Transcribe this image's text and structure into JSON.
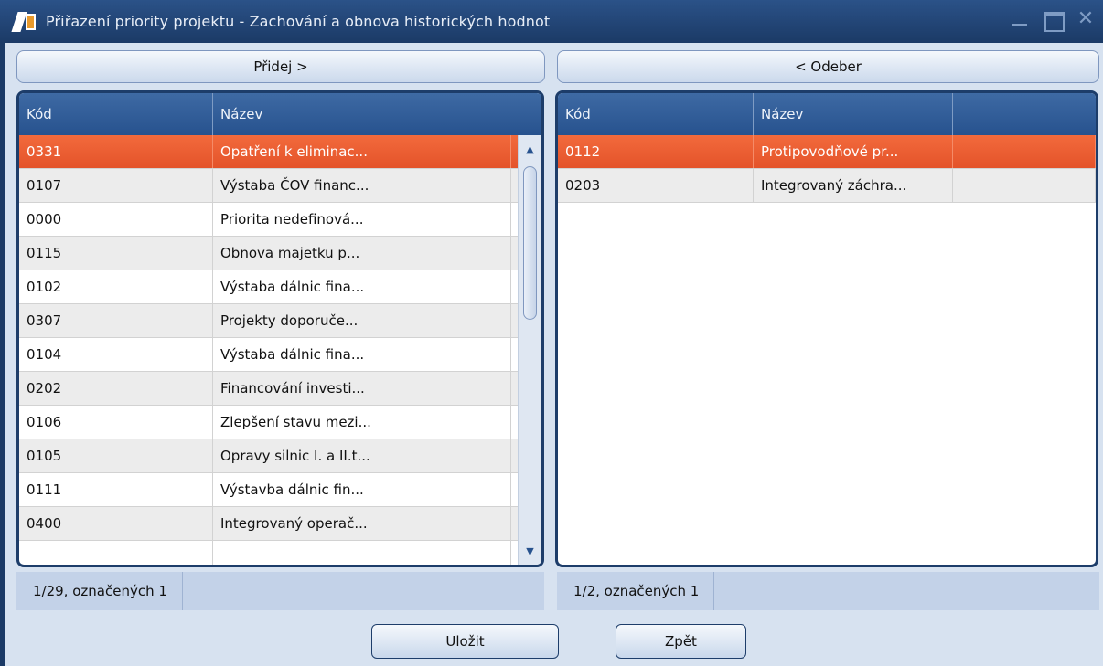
{
  "window": {
    "title": "Přiřazení priority projektu - Zachování a obnova historických hodnot",
    "icon": "app-logo-icon"
  },
  "actions": {
    "add_label": "Přidej  >",
    "remove_label": "<  Odeber",
    "save_label": "Uložit",
    "back_label": "Zpět"
  },
  "left_grid": {
    "columns": [
      "Kód",
      "Název",
      ""
    ],
    "rows": [
      {
        "code": "0331",
        "name": "Opatření k eliminac...",
        "selected": true
      },
      {
        "code": "0107",
        "name": "Výstaba ČOV financ..."
      },
      {
        "code": "0000",
        "name": "Priorita nedefinová..."
      },
      {
        "code": "0115",
        "name": "Obnova majetku p..."
      },
      {
        "code": "0102",
        "name": "Výstaba dálnic fina..."
      },
      {
        "code": "0307",
        "name": "Projekty doporuče..."
      },
      {
        "code": "0104",
        "name": "Výstaba dálnic fina..."
      },
      {
        "code": "0202",
        "name": "Financování investi..."
      },
      {
        "code": "0106",
        "name": "Zlepšení stavu mezi..."
      },
      {
        "code": "0105",
        "name": "Opravy silnic I. a II.t..."
      },
      {
        "code": "0111",
        "name": "Výstavba dálnic fin..."
      },
      {
        "code": "0400",
        "name": "Integrovaný operač..."
      },
      {
        "code": "",
        "name": ""
      }
    ],
    "status": "1/29, označených 1"
  },
  "right_grid": {
    "columns": [
      "Kód",
      "Název",
      ""
    ],
    "rows": [
      {
        "code": "0112",
        "name": "Protipovodňové pr...",
        "selected": true
      },
      {
        "code": "0203",
        "name": "Integrovaný záchra..."
      }
    ],
    "status": "1/2, označených 1"
  },
  "colors": {
    "title_bar": "#1b3a66",
    "header": "#27528e",
    "selection": "#e85a30",
    "background": "#d7e2f0"
  }
}
